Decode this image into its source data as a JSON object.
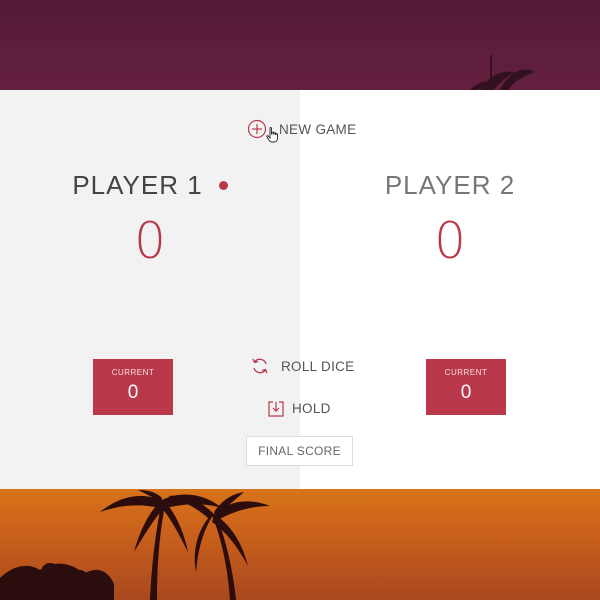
{
  "controls": {
    "new_game_label": "NEW GAME",
    "roll_dice_label": "ROLL DICE",
    "hold_label": "HOLD",
    "final_score_placeholder": "FINAL SCORE"
  },
  "players": [
    {
      "name": "PLAYER 1",
      "score": "0",
      "current_label": "CURRENT",
      "current_score": "0",
      "active": true
    },
    {
      "name": "PLAYER 2",
      "score": "0",
      "current_label": "CURRENT",
      "current_score": "0",
      "active": false
    }
  ],
  "colors": {
    "accent": "#b9394a",
    "active_panel": "#f3f2f3",
    "inactive_panel": "#ffffff"
  },
  "icons": {
    "new_game": "plus-circle-icon",
    "roll_dice": "refresh-icon",
    "hold": "download-icon",
    "active_indicator": "dot-icon"
  }
}
